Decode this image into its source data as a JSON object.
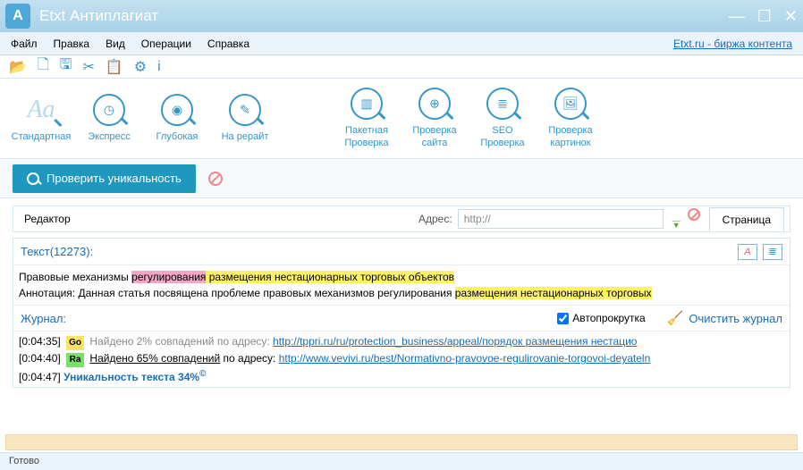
{
  "titlebar": {
    "title": "Etxt Антиплагиат"
  },
  "menubar": {
    "items": [
      "Файл",
      "Правка",
      "Вид",
      "Операции",
      "Справка"
    ],
    "link": "Etxt.ru - биржа контента"
  },
  "bigtoolbar": {
    "std": "Стандартная",
    "express": "Экспресс",
    "deep": "Глубокая",
    "rewrite": "На рерайт",
    "batch_line1": "Пакетная",
    "batch_line2": "Проверка",
    "site_line1": "Проверка",
    "site_line2": "сайта",
    "seo_line1": "SEO",
    "seo_line2": "Проверка",
    "img_line1": "Проверка",
    "img_line2": "картинок"
  },
  "checkbar": {
    "btn": "Проверить уникальность"
  },
  "addr": {
    "editor": "Редактор",
    "label": "Адрес:",
    "value": "http://",
    "tab": "Страница"
  },
  "editor": {
    "header": "Текст(12273):",
    "line1_a": "Правовые механизмы ",
    "line1_b": "регулирования",
    "line1_c": " размещения нестационарных торговых объектов",
    "line2_a": "Аннотация: Данная статья посвящена  проблеме правовых механизмов регулирования ",
    "line2_b": "размещения нестационарных торговых"
  },
  "journal": {
    "header": "Журнал:",
    "autoscroll": "Автопрокрутка",
    "clear": "Очистить журнал",
    "rows": [
      {
        "ts": "[0:04:35]",
        "badge": "Go",
        "badgeClass": "go",
        "text_a": "Найдено 2% совпадений",
        "text_b": " по адресу: ",
        "url": "http://tppri.ru/ru/protection_business/appeal/порядок размещения нестацио"
      },
      {
        "ts": "[0:04:40]",
        "badge": "Ra",
        "badgeClass": "ra",
        "text_a": "Найдено 65% совпадений",
        "text_b": " по адресу: ",
        "url": "http://www.vevivi.ru/best/Normativno-pravovoe-regulirovanie-torgovoi-deyateln"
      },
      {
        "ts": "[0:04:47]",
        "uniq": "Уникальность текста 34%"
      }
    ]
  },
  "status": "Готово"
}
